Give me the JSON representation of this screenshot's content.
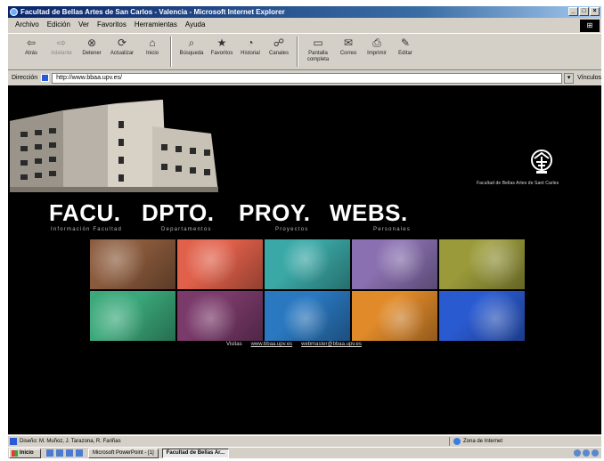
{
  "window": {
    "title": "Facultad de Bellas Artes de San Carlos - Valencia - Microsoft Internet Explorer",
    "controls": [
      "_",
      "□",
      "×"
    ]
  },
  "menu": {
    "items": [
      "Archivo",
      "Edición",
      "Ver",
      "Favoritos",
      "Herramientas",
      "Ayuda"
    ]
  },
  "toolbar": {
    "buttons": [
      {
        "label": "Atrás",
        "icon": "back-arrow-icon"
      },
      {
        "label": "Adelante",
        "icon": "forward-arrow-icon"
      },
      {
        "label": "Detener",
        "icon": "stop-icon"
      },
      {
        "label": "Actualizar",
        "icon": "refresh-icon"
      },
      {
        "label": "Inicio",
        "icon": "home-icon"
      },
      {
        "label": "Búsqueda",
        "icon": "search-icon"
      },
      {
        "label": "Favoritos",
        "icon": "favorites-icon"
      },
      {
        "label": "Historial",
        "icon": "history-icon"
      },
      {
        "label": "Canales",
        "icon": "channels-icon"
      },
      {
        "label": "Pantalla completa",
        "icon": "fullscreen-icon"
      },
      {
        "label": "Correo",
        "icon": "mail-icon"
      },
      {
        "label": "Imprimir",
        "icon": "print-icon"
      },
      {
        "label": "Editar",
        "icon": "edit-icon"
      }
    ]
  },
  "address": {
    "label": "Dirección",
    "value": "http://www.bbaa.upv.es/",
    "go_label": "Vínculos"
  },
  "page": {
    "logo_text": "Facultad de Bellas Artes de Sant Carles",
    "nav": [
      {
        "word": "FACU.",
        "sub": "Información Facultad"
      },
      {
        "word": "DPTO.",
        "sub": "Departamentos"
      },
      {
        "word": "PROY.",
        "sub": "Proyectos"
      },
      {
        "word": "WEBS.",
        "sub": "Personales"
      }
    ],
    "photos_row1": [
      "#8a5a3c",
      "#e0604a",
      "#3aa8a6",
      "#8a70b0",
      "#9a9a3a"
    ],
    "photos_row2": [
      "#3aa87a",
      "#7a3a6a",
      "#2a78c0",
      "#e08a2a",
      "#2a5ad0"
    ],
    "footer": {
      "prefix": "Visitas",
      "link1": "www.bbaa.upv.es",
      "link2": "webmaster@bbaa.upv.es"
    }
  },
  "status": {
    "text": "Diseño: M. Muñoz, J. Tarazona, R. Fariñas",
    "zone": "Zona de Internet"
  },
  "taskbar": {
    "start": "Inicio",
    "tasks": [
      {
        "label": "Microsoft PowerPoint - [1]",
        "active": false
      },
      {
        "label": "Facultad de Bellas Ar...",
        "active": true
      }
    ]
  }
}
